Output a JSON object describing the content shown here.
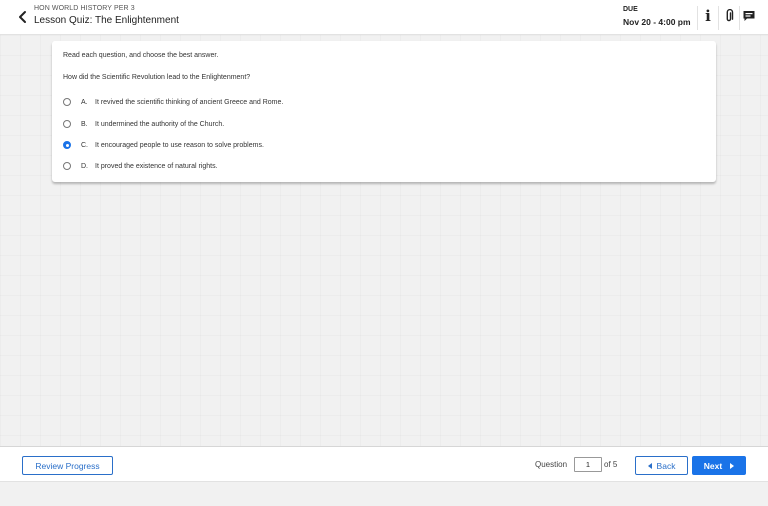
{
  "header": {
    "course": "HON WORLD HISTORY PER 3",
    "title": "Lesson Quiz: The Enlightenment",
    "due_label": "DUE",
    "due_date": "Nov 20 - 4:00 pm",
    "icons": [
      "back-chevron-icon",
      "info-icon",
      "attachment-icon",
      "comment-icon"
    ]
  },
  "quiz": {
    "instructions": "Read each question, and choose the best answer.",
    "question": "How did the Scientific Revolution lead to the Enlightenment?",
    "selected": "C",
    "options": [
      {
        "letter": "A.",
        "text": "It revived the scientific thinking of ancient Greece and Rome."
      },
      {
        "letter": "B.",
        "text": "It undermined the authority of the Church."
      },
      {
        "letter": "C.",
        "text": "It encouraged people to use reason to solve problems."
      },
      {
        "letter": "D.",
        "text": "It proved the existence of natural rights."
      }
    ]
  },
  "footer": {
    "review_label": "Review Progress",
    "question_label": "Question",
    "question_value": "1",
    "of_label": "of 5",
    "back_label": "Back",
    "next_label": "Next"
  },
  "colors": {
    "accent": "#1a73e8",
    "outline_blue": "#2a6fc9"
  }
}
